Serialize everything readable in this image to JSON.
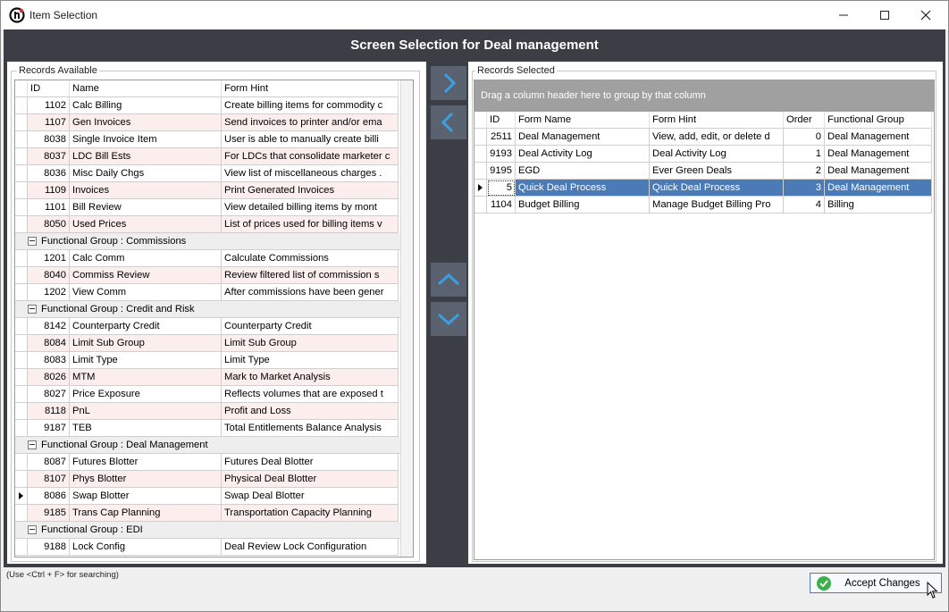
{
  "window": {
    "title": "Item Selection",
    "header": "Screen Selection for Deal management"
  },
  "available": {
    "legend": "Records Available",
    "columns": [
      "ID",
      "Name",
      "Form Hint"
    ],
    "rows": [
      {
        "id": "1102",
        "name": "Calc Billing",
        "hint": "Create billing items for commodity c"
      },
      {
        "id": "1107",
        "name": "Gen Invoices",
        "hint": "Send invoices to printer and/or ema"
      },
      {
        "id": "8038",
        "name": "Single Invoice Item",
        "hint": "User is able to manually create billi"
      },
      {
        "id": "8037",
        "name": "LDC Bill Ests",
        "hint": "For LDCs that consolidate marketer c"
      },
      {
        "id": "8036",
        "name": "Misc Daily Chgs",
        "hint": "View list of miscellaneous charges ."
      },
      {
        "id": "1109",
        "name": "Invoices",
        "hint": "Print Generated Invoices"
      },
      {
        "id": "1101",
        "name": "Bill Review",
        "hint": "View detailed billing items by mont"
      },
      {
        "id": "8050",
        "name": "Used Prices",
        "hint": "List of prices used for billing items v"
      },
      {
        "group": "Functional Group : Commissions"
      },
      {
        "id": "1201",
        "name": "Calc Comm",
        "hint": "Calculate Commissions"
      },
      {
        "id": "8040",
        "name": "Commiss Review",
        "hint": "Review filtered list of commission s"
      },
      {
        "id": "1202",
        "name": "View Comm",
        "hint": "After commissions have been gener"
      },
      {
        "group": "Functional Group : Credit and Risk"
      },
      {
        "id": "8142",
        "name": "Counterparty Credit",
        "hint": "Counterparty Credit"
      },
      {
        "id": "8084",
        "name": "Limit Sub Group",
        "hint": "Limit Sub Group"
      },
      {
        "id": "8083",
        "name": "Limit Type",
        "hint": "Limit Type"
      },
      {
        "id": "8026",
        "name": "MTM",
        "hint": "Mark to Market Analysis"
      },
      {
        "id": "8027",
        "name": "Price Exposure",
        "hint": "Reflects volumes that are exposed t"
      },
      {
        "id": "8118",
        "name": "PnL",
        "hint": "Profit and Loss"
      },
      {
        "id": "9187",
        "name": "TEB",
        "hint": "Total Entitlements Balance Analysis"
      },
      {
        "group": "Functional Group : Deal Management"
      },
      {
        "id": "8087",
        "name": "Futures Blotter",
        "hint": "Futures Deal Blotter"
      },
      {
        "id": "8107",
        "name": "Phys Blotter",
        "hint": "Physical Deal Blotter"
      },
      {
        "id": "8086",
        "name": "Swap Blotter",
        "hint": "Swap Deal Blotter",
        "current": true
      },
      {
        "id": "9185",
        "name": "Trans Cap Planning",
        "hint": "Transportation Capacity Planning"
      },
      {
        "group": "Functional Group : EDI"
      },
      {
        "id": "9188",
        "name": "Lock Config",
        "hint": "Deal Review Lock Configuration"
      }
    ]
  },
  "selected": {
    "legend": "Records Selected",
    "group_hint": "Drag a column header here to group by that column",
    "columns": [
      "ID",
      "Form Name",
      "Form Hint",
      "Order",
      "Functional Group"
    ],
    "rows": [
      {
        "id": "2511",
        "name": "Deal Management",
        "hint": "View, add, edit, or delete d",
        "order": "0",
        "group": "Deal Management"
      },
      {
        "id": "9193",
        "name": "Deal Activity Log",
        "hint": "Deal Activity Log",
        "order": "1",
        "group": "Deal Management"
      },
      {
        "id": "9195",
        "name": "EGD",
        "hint": "Ever Green Deals",
        "order": "2",
        "group": "Deal Management"
      },
      {
        "id": "5",
        "name": "Quick Deal Process",
        "hint": "Quick Deal Process",
        "order": "3",
        "group": "Deal Management",
        "selected": true
      },
      {
        "id": "1104",
        "name": "Budget Billing",
        "hint": "Manage Budget Billing Pro",
        "order": "4",
        "group": "Billing"
      }
    ]
  },
  "footer": {
    "hint": "(Use <Ctrl + F> for searching)",
    "accept_label": "Accept Changes"
  },
  "icons": {
    "app": "app-logo-icon",
    "move_right": "chevron-right-icon",
    "move_left": "chevron-left-icon",
    "move_up": "chevron-up-icon",
    "move_down": "chevron-down-icon",
    "accept": "check-circle-icon"
  },
  "colors": {
    "band": "#3b3f45",
    "arrow_button": "#5a6270",
    "arrow_glyph": "#3aa0e0",
    "selection": "#4a7bb7",
    "alt_row": "#fbeeed",
    "accept_check": "#3bb14a"
  }
}
